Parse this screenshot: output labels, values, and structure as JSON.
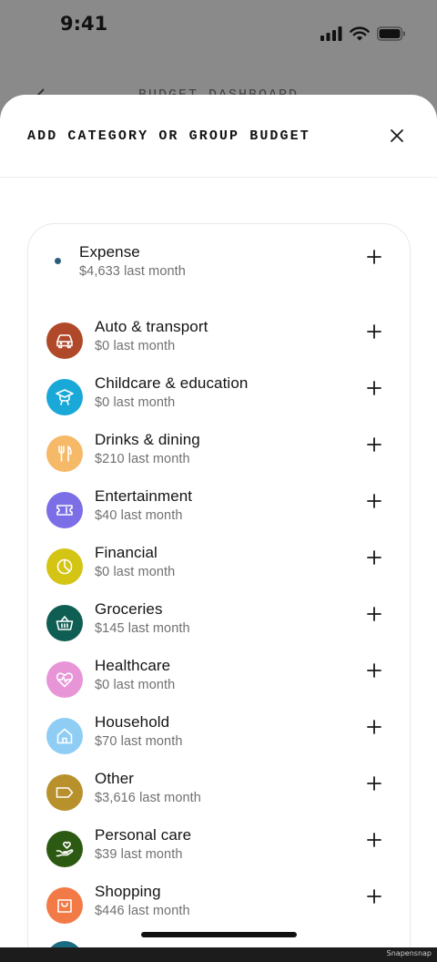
{
  "status": {
    "time": "9:41"
  },
  "underlay": {
    "title": "BUDGET DASHBOARD"
  },
  "sheet": {
    "title": "ADD CATEGORY OR GROUP BUDGET"
  },
  "group": {
    "name": "Expense",
    "sub": "$4,633 last month",
    "color": "#2c5f7c"
  },
  "categories": [
    {
      "name": "Auto & transport",
      "sub": "$0 last month",
      "color": "#b0492a",
      "icon": "car-icon"
    },
    {
      "name": "Childcare & education",
      "sub": "$0 last month",
      "color": "#1aa8d8",
      "icon": "graduation-cap-icon"
    },
    {
      "name": "Drinks & dining",
      "sub": "$210 last month",
      "color": "#f5b967",
      "icon": "fork-knife-icon"
    },
    {
      "name": "Entertainment",
      "sub": "$40 last month",
      "color": "#7b6ee6",
      "icon": "ticket-icon"
    },
    {
      "name": "Financial",
      "sub": "$0 last month",
      "color": "#d4c414",
      "icon": "pie-chart-icon"
    },
    {
      "name": "Groceries",
      "sub": "$145 last month",
      "color": "#0f5e53",
      "icon": "basket-icon"
    },
    {
      "name": "Healthcare",
      "sub": "$0 last month",
      "color": "#e895d8",
      "icon": "heartbeat-icon"
    },
    {
      "name": "Household",
      "sub": "$70 last month",
      "color": "#8fcdf5",
      "icon": "house-icon"
    },
    {
      "name": "Other",
      "sub": "$3,616 last month",
      "color": "#b8912c",
      "icon": "tag-icon"
    },
    {
      "name": "Personal care",
      "sub": "$39 last month",
      "color": "#2d5a12",
      "icon": "hand-heart-icon"
    },
    {
      "name": "Shopping",
      "sub": "$446 last month",
      "color": "#f27a47",
      "icon": "shopping-bag-icon"
    }
  ],
  "partial": {
    "color": "#1a6a82"
  },
  "watermark": "Snapensnap"
}
